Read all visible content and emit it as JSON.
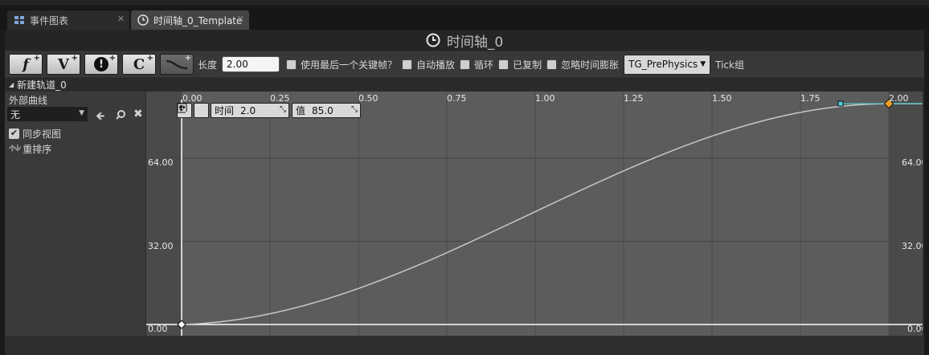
{
  "tabs": [
    {
      "label": "事件图表",
      "icon": "graph-icon"
    },
    {
      "label": "时间轴_0_Template",
      "icon": "clock-icon",
      "active": true
    }
  ],
  "title": "时间轴_0",
  "toolbar": {
    "buttons": [
      {
        "glyph": "f",
        "name": "add-float-track"
      },
      {
        "glyph": "V",
        "name": "add-vector-track"
      },
      {
        "glyph": "!",
        "name": "add-event-track"
      },
      {
        "glyph": "C",
        "name": "add-color-track"
      },
      {
        "glyph": "",
        "name": "add-external-curve"
      }
    ],
    "plus": "+",
    "length_label": "长度",
    "length_value": "2.00",
    "checkboxes": [
      {
        "label": "使用最后一个关键帧？",
        "checked": false
      },
      {
        "label": "自动播放",
        "checked": false
      },
      {
        "label": "循环",
        "checked": false
      },
      {
        "label": "已复制",
        "checked": false
      },
      {
        "label": "忽略时间膨胀",
        "checked": false
      }
    ],
    "tick_group_value": "TG_PrePhysics",
    "tick_group_label": "Tick组"
  },
  "track": {
    "name": "新建轨道_0",
    "external_curve_label": "外部曲线",
    "external_curve_value": "无",
    "sync_view_label": "同步视图",
    "sync_view_checked": true,
    "reorder_label": "重排序"
  },
  "graph": {
    "x_ticks": [
      "0.00",
      "0.25",
      "0.50",
      "0.75",
      "1.00",
      "1.25",
      "1.50",
      "1.75",
      "2.00"
    ],
    "y_ticks": [
      "64.00",
      "32.00",
      "0.00"
    ],
    "key_time_label": "时间",
    "key_time_value": "2.0",
    "key_value_label": "值",
    "key_value_value": "85.0",
    "keys": [
      {
        "time": 0.0,
        "value": 0.0
      },
      {
        "time": 2.0,
        "value": 85.0
      }
    ],
    "colors": {
      "curve": "#c8c8c8",
      "selected_key": "#f0a020",
      "tangent": "#4fd2e0",
      "background": "#5c5c5c",
      "outside_range": "#4a4a4a"
    }
  }
}
